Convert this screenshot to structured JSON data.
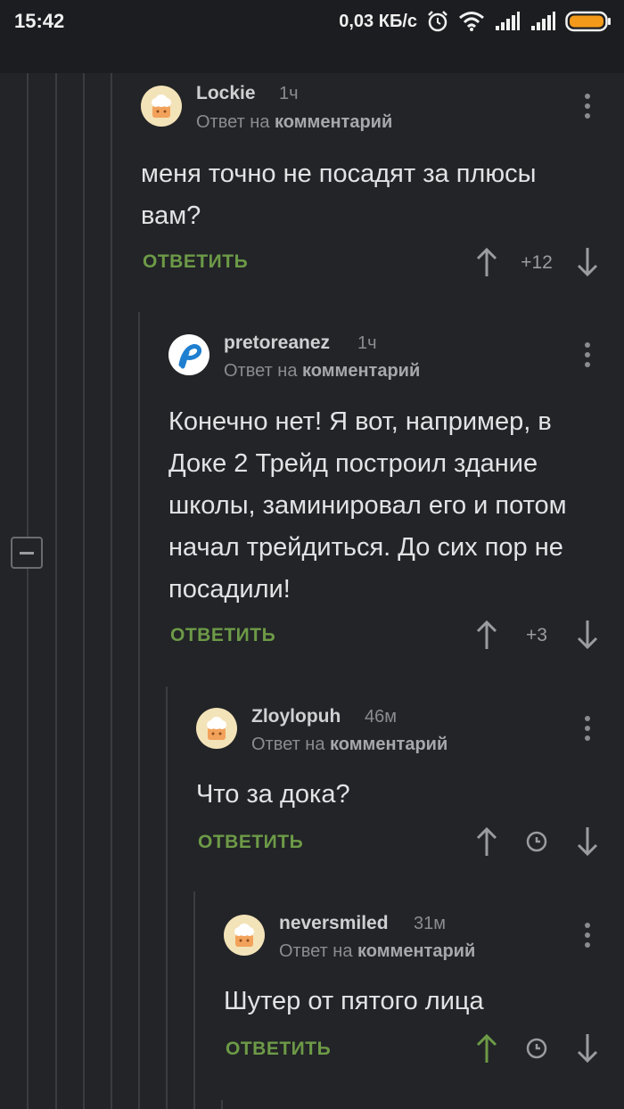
{
  "status_bar": {
    "time": "15:42",
    "speed": "0,03 КБ/с"
  },
  "comments": [
    {
      "username": "Lockie",
      "time_ago": "1ч",
      "reply_prefix": "Ответ на",
      "reply_link": "комментарий",
      "text": "меня точно не посадят за плюсы вам?",
      "reply_label": "ОТВЕТИТЬ",
      "score": "+12"
    },
    {
      "username": "pretoreanez",
      "time_ago": "1ч",
      "reply_prefix": "Ответ на",
      "reply_link": "комментарий",
      "text": "Конечно нет! Я вот, например, в Доке 2 Трейд построил здание школы, заминировал его и потом начал трейдиться. До сих пор не посадили!",
      "reply_label": "ОТВЕТИТЬ",
      "score": "+3"
    },
    {
      "username": "Zloylopuh",
      "time_ago": "46м",
      "reply_prefix": "Ответ на",
      "reply_link": "комментарий",
      "text": "Что за дока?",
      "reply_label": "ОТВЕТИТЬ",
      "score": null
    },
    {
      "username": "neversmiled",
      "time_ago": "31м",
      "reply_prefix": "Ответ на",
      "reply_link": "комментарий",
      "text": "Шутер от пятого лица",
      "reply_label": "ОТВЕТИТЬ",
      "score": null
    }
  ],
  "colors": {
    "background": "#222427",
    "accent_green": "#6d9a47",
    "muted": "#8a8c90"
  }
}
